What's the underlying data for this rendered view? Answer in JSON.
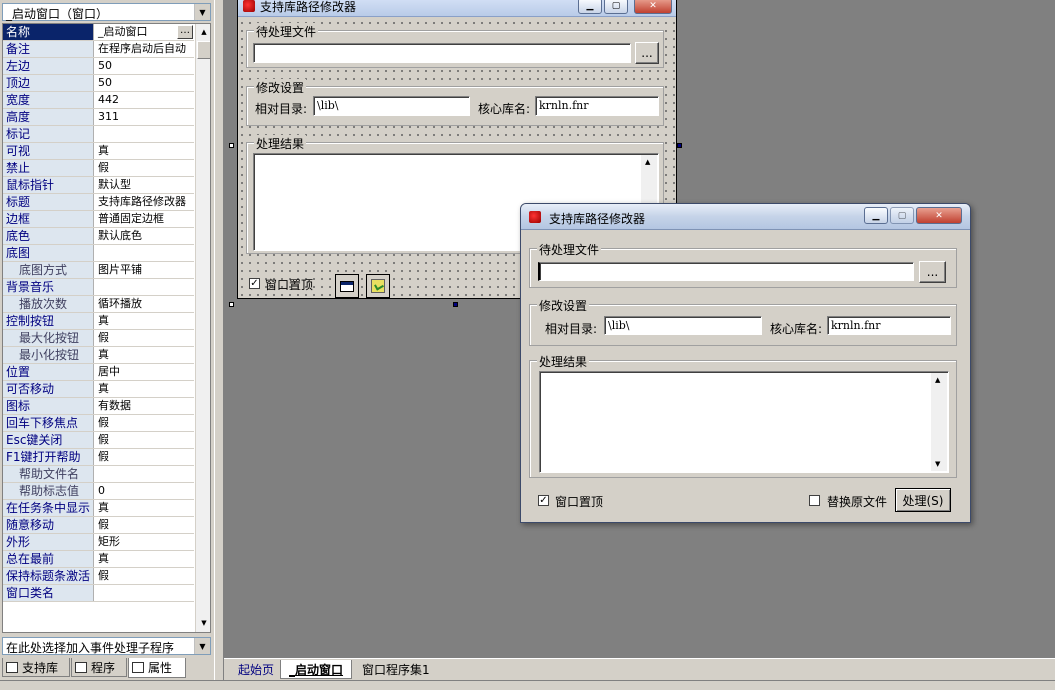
{
  "object_selector": {
    "value": "_启动窗口（窗口）"
  },
  "properties": [
    {
      "name": "名称",
      "value": "_启动窗口",
      "sub": false,
      "selected": true,
      "dots": true
    },
    {
      "name": "备注",
      "value": "在程序启动后自动",
      "sub": false
    },
    {
      "name": "左边",
      "value": "50",
      "sub": false
    },
    {
      "name": "顶边",
      "value": "50",
      "sub": false
    },
    {
      "name": "宽度",
      "value": "442",
      "sub": false
    },
    {
      "name": "高度",
      "value": "311",
      "sub": false
    },
    {
      "name": "标记",
      "value": "",
      "sub": false
    },
    {
      "name": "可视",
      "value": "真",
      "sub": false
    },
    {
      "name": "禁止",
      "value": "假",
      "sub": false
    },
    {
      "name": "鼠标指针",
      "value": "默认型",
      "sub": false
    },
    {
      "name": "标题",
      "value": "支持库路径修改器",
      "sub": false
    },
    {
      "name": "边框",
      "value": "普通固定边框",
      "sub": false
    },
    {
      "name": "底色",
      "value": "默认底色",
      "sub": false
    },
    {
      "name": "底图",
      "value": "",
      "sub": false
    },
    {
      "name": "底图方式",
      "value": "图片平铺",
      "sub": true
    },
    {
      "name": "背景音乐",
      "value": "",
      "sub": false
    },
    {
      "name": "播放次数",
      "value": "循环播放",
      "sub": true
    },
    {
      "name": "控制按钮",
      "value": "真",
      "sub": false
    },
    {
      "name": "最大化按钮",
      "value": "假",
      "sub": true
    },
    {
      "name": "最小化按钮",
      "value": "真",
      "sub": true
    },
    {
      "name": "位置",
      "value": "居中",
      "sub": false
    },
    {
      "name": "可否移动",
      "value": "真",
      "sub": false
    },
    {
      "name": "图标",
      "value": "有数据",
      "sub": false
    },
    {
      "name": "回车下移焦点",
      "value": "假",
      "sub": false
    },
    {
      "name": "Esc键关闭",
      "value": "假",
      "sub": false
    },
    {
      "name": "F1键打开帮助",
      "value": "假",
      "sub": false
    },
    {
      "name": "帮助文件名",
      "value": "",
      "sub": true
    },
    {
      "name": "帮助标志值",
      "value": "0",
      "sub": true
    },
    {
      "name": "在任务条中显示",
      "value": "真",
      "sub": false
    },
    {
      "name": "随意移动",
      "value": "假",
      "sub": false
    },
    {
      "name": "外形",
      "value": "矩形",
      "sub": false
    },
    {
      "name": "总在最前",
      "value": "真",
      "sub": false
    },
    {
      "name": "保持标题条激活",
      "value": "假",
      "sub": false
    },
    {
      "name": "窗口类名",
      "value": "",
      "sub": false
    }
  ],
  "event_selector": {
    "value": "在此处选择加入事件处理子程序"
  },
  "left_tabs": [
    {
      "label": "支持库",
      "icon": "library-icon"
    },
    {
      "label": "程序",
      "icon": "program-icon"
    },
    {
      "label": "属性",
      "icon": "properties-icon"
    }
  ],
  "design_form": {
    "title": "支持库路径修改器",
    "file_group": "待处理文件",
    "file_value": "",
    "browse_label": "...",
    "settings_group": "修改设置",
    "rel_dir_label": "相对目录:",
    "rel_dir_value": "\\lib\\",
    "core_lib_label": "核心库名:",
    "core_lib_value": "krnln.fnr",
    "result_group": "处理结果",
    "topmost_label": "窗口置顶",
    "topmost_checked": true
  },
  "preview_window": {
    "title": "支持库路径修改器",
    "file_group": "待处理文件",
    "file_value": "",
    "browse_label": "...",
    "settings_group": "修改设置",
    "rel_dir_label": "相对目录:",
    "rel_dir_value": "\\lib\\",
    "core_lib_label": "核心库名:",
    "core_lib_value": "krnln.fnr",
    "result_group": "处理结果",
    "topmost_label": "窗口置顶",
    "topmost_checked": true,
    "replace_label": "替换原文件",
    "replace_checked": false,
    "process_label": "处理(S)"
  },
  "doc_tabs": [
    {
      "label": "起始页",
      "active": false
    },
    {
      "label": "_启动窗口",
      "active": true
    },
    {
      "label": "窗口程序集1",
      "active": false
    }
  ]
}
